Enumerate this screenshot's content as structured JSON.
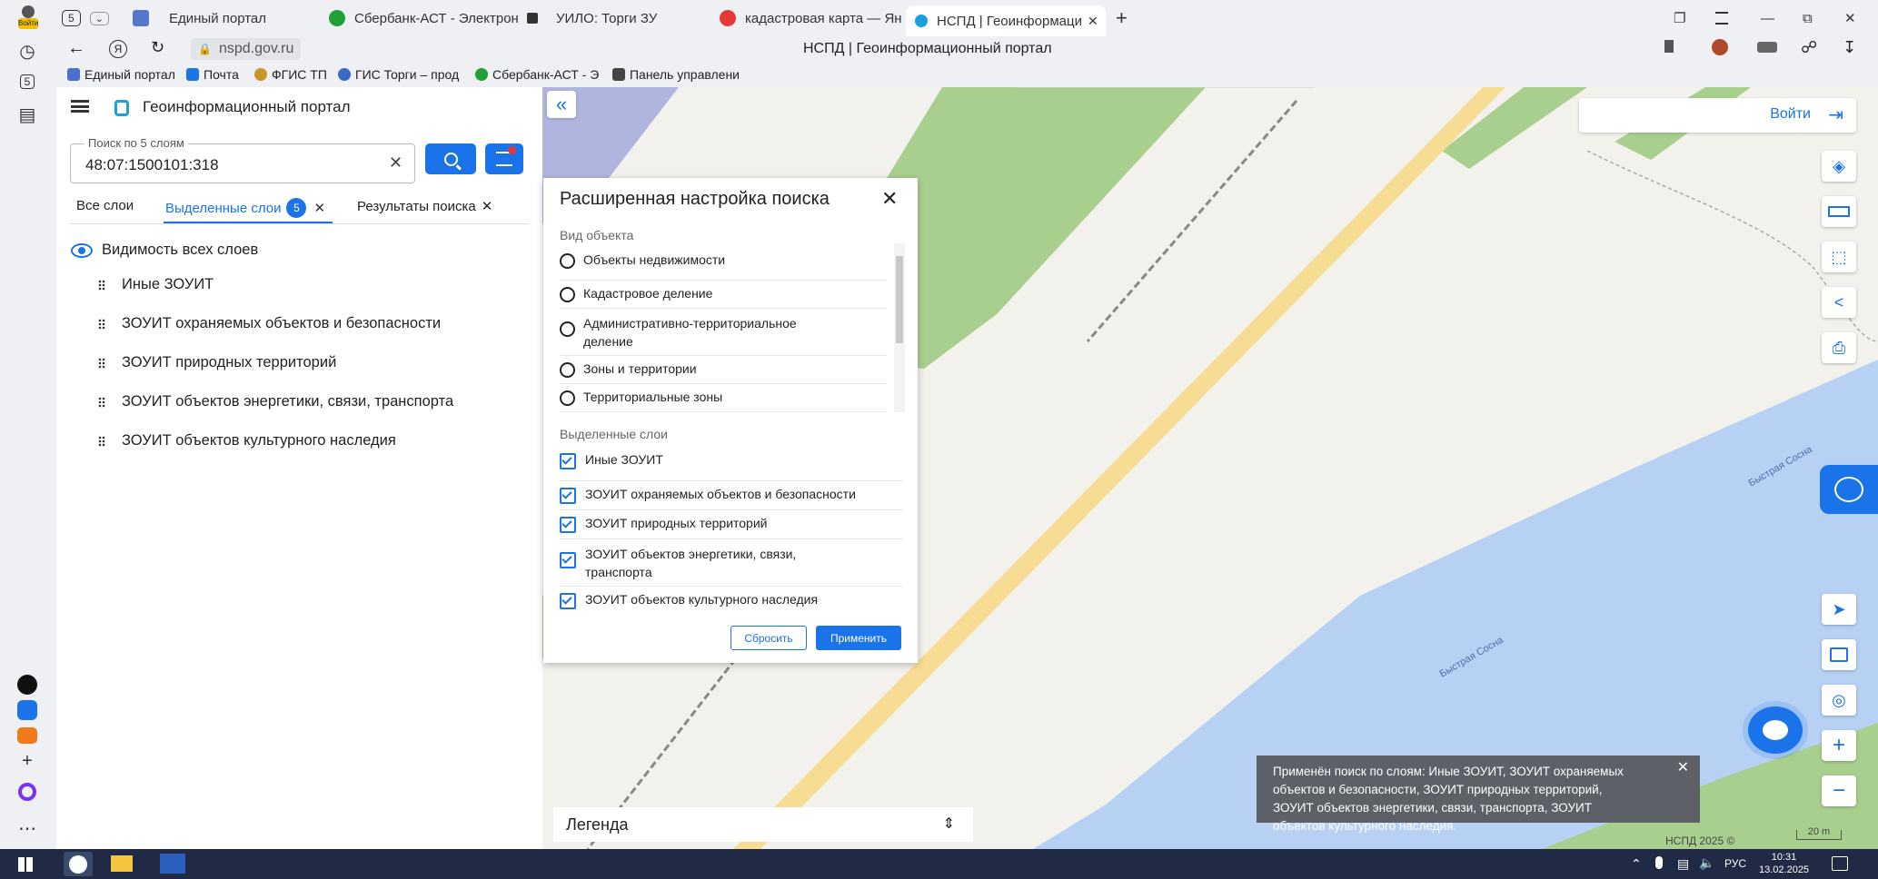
{
  "browser": {
    "profile_label": "Войти",
    "tab_count_badge": "5",
    "tabs": [
      {
        "title": "Единый портал",
        "icon": "gosuslugi-icon"
      },
      {
        "title": "Сбербанк-АСТ - Электрон",
        "icon": "sberbank-ast-icon"
      },
      {
        "title": "УИЛО: Торги ЗУ",
        "icon": "uilo-icon"
      },
      {
        "title": "кадастровая карта — Янд",
        "icon": "yandex-icon"
      },
      {
        "title": "НСПД | Геоинформаци",
        "icon": "nspd-icon"
      }
    ],
    "new_tab_label": "+",
    "url": "nspd.gov.ru",
    "page_title": "НСПД | Геоинформационный портал",
    "bookmarks": [
      {
        "label": "Единый портал",
        "color": "#4a6fd1"
      },
      {
        "label": "Почта",
        "color": "#1a73e8"
      },
      {
        "label": "ФГИС ТП",
        "color": "#c8962a"
      },
      {
        "label": "ГИС Торги – прод",
        "color": "#3a6ac8"
      },
      {
        "label": "Сбербанк-АСТ - Э",
        "color": "#21a038"
      },
      {
        "label": "Панель управлени",
        "color": "#444"
      }
    ],
    "sidebar_badge": "5"
  },
  "panel": {
    "app_title": "Геоинформационный портал",
    "search_label": "Поиск по 5 слоям",
    "search_value": "48:07:1500101:318",
    "tabs": {
      "all": "Все слои",
      "selected": "Выделенные слои",
      "selected_count": "5",
      "results": "Результаты поиска"
    },
    "visibility_label": "Видимость всех слоев",
    "layers": [
      "Иные ЗОУИТ",
      "ЗОУИТ охраняемых объектов и безопасности",
      "ЗОУИТ природных территорий",
      "ЗОУИТ объектов энергетики, связи, транспорта",
      "ЗОУИТ объектов культурного наследия"
    ]
  },
  "modal": {
    "title": "Расширенная настройка поиска",
    "object_type_heading": "Вид объекта",
    "object_types": [
      "Объекты недвижимости",
      "Кадастровое деление",
      "Административно-территориальное деление",
      "Зоны и территории",
      "Территориальные зоны"
    ],
    "selected_heading": "Выделенные слои",
    "selected_layers": [
      "Иные ЗОУИТ",
      "ЗОУИТ охраняемых объектов и безопасности",
      "ЗОУИТ природных территорий",
      "ЗОУИТ объектов энергетики, связи, транспорта",
      "ЗОУИТ объектов культурного наследия"
    ],
    "reset_label": "Сбросить",
    "apply_label": "Применить"
  },
  "map": {
    "login_label": "Войти",
    "river_label_1": "Быстрая Сосна",
    "river_label_2": "Быстрая Сосна",
    "legend_label": "Легенда",
    "toast_text": "Применён поиск по слоям: Иные ЗОУИТ, ЗОУИТ охраняемых объектов и безопасности, ЗОУИТ природных территорий, ЗОУИТ объектов энергетики, связи, транспорта, ЗОУИТ объектов культурного наследия.",
    "copyright": "НСПД 2025 ©",
    "scale_label": "20 m",
    "colors": {
      "water": "#b7d1f5",
      "green": "#a9cf8f",
      "road": "#f7dc93",
      "bg": "#f3f1ec",
      "rail": "#b0b5e0"
    }
  },
  "taskbar": {
    "lang": "РУС",
    "time": "10:31",
    "date": "13.02.2025"
  }
}
